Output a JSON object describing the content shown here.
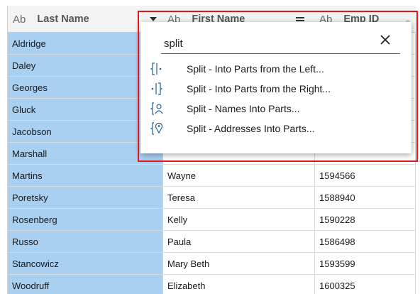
{
  "columns": [
    {
      "type_label": "Ab",
      "name": "Last Name"
    },
    {
      "type_label": "Ab",
      "name": "First Name"
    },
    {
      "type_label": "Ab",
      "name": "Emp ID"
    }
  ],
  "rows": [
    {
      "last": "Aldridge",
      "first": "",
      "id": ""
    },
    {
      "last": "Daley",
      "first": "",
      "id": ""
    },
    {
      "last": "Georges",
      "first": "",
      "id": ""
    },
    {
      "last": "Gluck",
      "first": "",
      "id": ""
    },
    {
      "last": "Jacobson",
      "first": "",
      "id": ""
    },
    {
      "last": "Marshall",
      "first": "",
      "id": ""
    },
    {
      "last": "Martins",
      "first": "Wayne",
      "id": "1594566"
    },
    {
      "last": "Poretsky",
      "first": "Teresa",
      "id": "1588940"
    },
    {
      "last": "Rosenberg",
      "first": "Kelly",
      "id": "1590228"
    },
    {
      "last": "Russo",
      "first": "Paula",
      "id": "1586498"
    },
    {
      "last": "Stancowicz",
      "first": "Mary Beth",
      "id": "1593599"
    },
    {
      "last": "Woodruff",
      "first": "Elizabeth",
      "id": "1600325"
    }
  ],
  "popup": {
    "search_value": "split",
    "close_glyph": "✕",
    "items": [
      {
        "label": "Split - Into Parts from the Left...",
        "icon": "split-left-icon"
      },
      {
        "label": "Split - Into Parts from the Right...",
        "icon": "split-right-icon"
      },
      {
        "label": "Split - Names Into Parts...",
        "icon": "split-names-icon"
      },
      {
        "label": "Split - Addresses Into Parts...",
        "icon": "split-addresses-icon"
      }
    ]
  },
  "colors": {
    "selected_column": "#a9cff1",
    "highlight_border": "#e3141b",
    "icon_blue": "#1f5f9e"
  }
}
